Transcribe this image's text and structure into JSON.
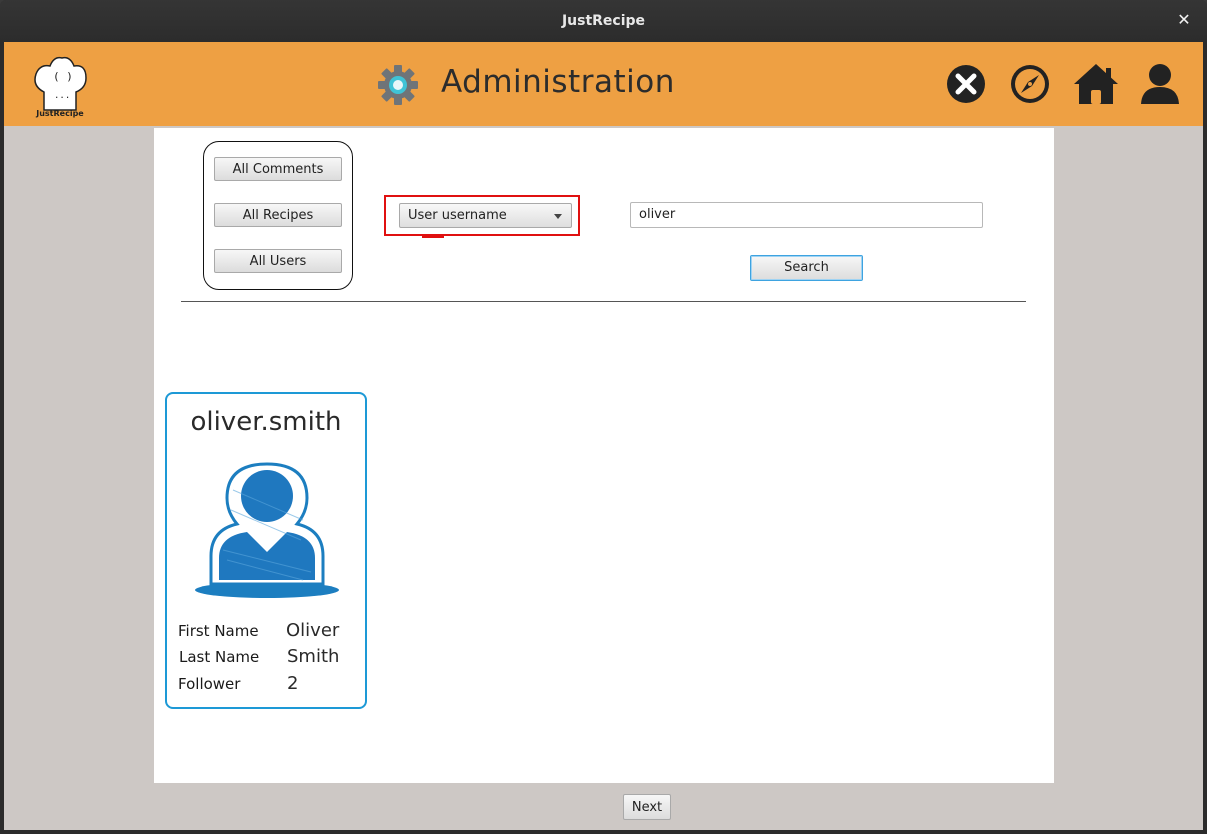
{
  "window": {
    "title": "JustRecipe",
    "close_glyph": "✕"
  },
  "header": {
    "logo_label": "JustRecipe",
    "title": "Administration",
    "icons": [
      "close-circle-icon",
      "compass-icon",
      "home-icon",
      "user-icon"
    ],
    "accent_color": "#eea043"
  },
  "filters": {
    "all_comments": "All Comments",
    "all_recipes": "All Recipes",
    "all_users": "All Users"
  },
  "search": {
    "criterion_selected": "User username",
    "query": "oliver",
    "button": "Search"
  },
  "results": [
    {
      "username": "oliver.smith",
      "first_name_label": "First Name",
      "first_name": "Oliver",
      "last_name_label": "Last Name",
      "last_name": "Smith",
      "follower_label": "Follower",
      "follower": "2"
    }
  ],
  "pagination": {
    "next": "Next"
  }
}
